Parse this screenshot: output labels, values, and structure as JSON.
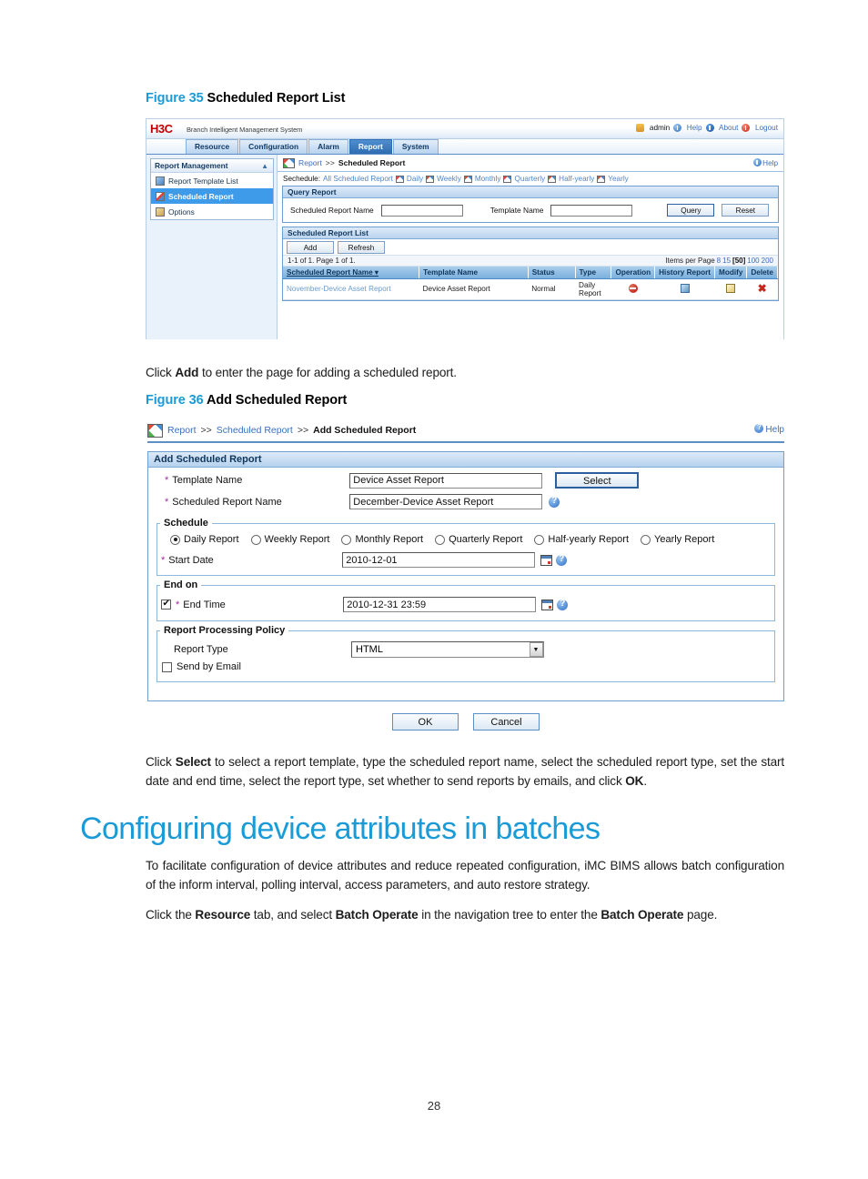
{
  "document": {
    "page_number": "28"
  },
  "figure35": {
    "fig_number": "Figure 35",
    "fig_title": "Scheduled Report List",
    "banner": {
      "logo": "H3C",
      "product": "Branch Intelligent Management System",
      "user": "admin",
      "help": "Help",
      "about": "About",
      "logout": "Logout"
    },
    "tabs": [
      {
        "label": "Resource",
        "active": false
      },
      {
        "label": "Configuration",
        "active": false
      },
      {
        "label": "Alarm",
        "active": false
      },
      {
        "label": "Report",
        "active": true
      },
      {
        "label": "System",
        "active": false
      }
    ],
    "sidebar": {
      "title": "Report Management",
      "collapse_icon": "chevron-up-icon",
      "items": [
        {
          "label": "Report Template List",
          "active": false
        },
        {
          "label": "Scheduled Report",
          "active": true
        },
        {
          "label": "Options",
          "active": false
        }
      ]
    },
    "breadcrumb": {
      "root": "Report",
      "separator": ">>",
      "current": "Scheduled Report",
      "help": "Help"
    },
    "schedule_filter": {
      "label": "Sechedule:",
      "links": [
        "All Scheduled Report",
        "Daily",
        "Weekly",
        "Monthly",
        "Quarterly",
        "Half-yearly",
        "Yearly"
      ]
    },
    "query_panel": {
      "title": "Query Report",
      "field1_label": "Scheduled Report Name",
      "field1_value": "",
      "field2_label": "Template Name",
      "field2_value": "",
      "query_button": "Query",
      "reset_button": "Reset"
    },
    "list_panel": {
      "title": "Scheduled Report List",
      "add_button": "Add",
      "refresh_button": "Refresh",
      "page_info": "1-1 of 1. Page 1 of 1.",
      "items_per_page_label": "Items per Page",
      "items_per_page_options": [
        "8",
        "15",
        "50",
        "100",
        "200"
      ],
      "items_per_page_selected": "50",
      "columns": [
        "Scheduled Report Name",
        "Template Name",
        "Status",
        "Type",
        "Operation",
        "History Report",
        "Modify",
        "Delete"
      ],
      "sort_indicator": "▾",
      "rows": [
        {
          "name": "November-Device Asset Report",
          "template": "Device Asset Report",
          "status": "Normal",
          "type": "Daily Report",
          "operation_icon": "stop-icon",
          "history_icon": "history-report-icon",
          "modify_icon": "modify-icon",
          "delete_icon": "delete-icon"
        }
      ]
    }
  },
  "paragraph_add": {
    "part1": "Click ",
    "bold1": "Add",
    "part2": " to enter the page for adding a scheduled report."
  },
  "figure36": {
    "fig_number": "Figure 36",
    "fig_title": "Add Scheduled Report",
    "breadcrumb": {
      "root": "Report",
      "sep1": ">>",
      "mid": "Scheduled Report",
      "sep2": ">>",
      "current": "Add Scheduled Report",
      "help": "Help"
    },
    "form_title": "Add Scheduled Report",
    "template_name": {
      "label": "Template Name",
      "value": "Device Asset Report",
      "required": "*",
      "select_button": "Select"
    },
    "scheduled_report_name": {
      "label": "Scheduled Report Name",
      "value": "December-Device Asset Report",
      "required": "*",
      "help_icon": "help-icon"
    },
    "schedule_group": {
      "legend": "Schedule",
      "options": [
        {
          "label": "Daily Report",
          "selected": true
        },
        {
          "label": "Weekly Report",
          "selected": false
        },
        {
          "label": "Monthly Report",
          "selected": false
        },
        {
          "label": "Quarterly Report",
          "selected": false
        },
        {
          "label": "Half-yearly Report",
          "selected": false
        },
        {
          "label": "Yearly Report",
          "selected": false
        }
      ],
      "start_date_label": "Start Date",
      "start_date_value": "2010-12-01",
      "start_date_required": "*",
      "calendar_icon": "calendar-icon"
    },
    "end_on_group": {
      "legend": "End on",
      "checkbox_checked": true,
      "end_time_label": "End Time",
      "end_time_value": "2010-12-31 23:59",
      "end_time_required": "*",
      "calendar_icon": "calendar-icon"
    },
    "policy_group": {
      "legend": "Report Processing Policy",
      "report_type_label": "Report Type",
      "report_type_value": "HTML",
      "report_type_options": [
        "HTML"
      ],
      "send_by_email_label": "Send by Email",
      "send_by_email_checked": false
    },
    "ok_button": "OK",
    "cancel_button": "Cancel"
  },
  "paragraph_select": {
    "part1": "Click ",
    "bold1": "Select",
    "part2": " to select a report template, type the scheduled report name, select the scheduled report type, set the start date and end time, select the report type, set whether to send reports by emails, and click ",
    "bold2": "OK",
    "part3": "."
  },
  "section": {
    "heading": "Configuring device attributes in batches",
    "para1": "To facilitate configuration of device attributes and reduce repeated configuration, iMC BIMS allows batch configuration of the inform interval, polling interval, access parameters, and auto restore strategy.",
    "para2_part1": "Click the ",
    "para2_bold1": "Resource",
    "para2_part2": " tab, and select ",
    "para2_bold2": "Batch Operate",
    "para2_part3": " in the navigation tree to enter the ",
    "para2_bold3": "Batch Operate",
    "para2_part4": " page."
  }
}
